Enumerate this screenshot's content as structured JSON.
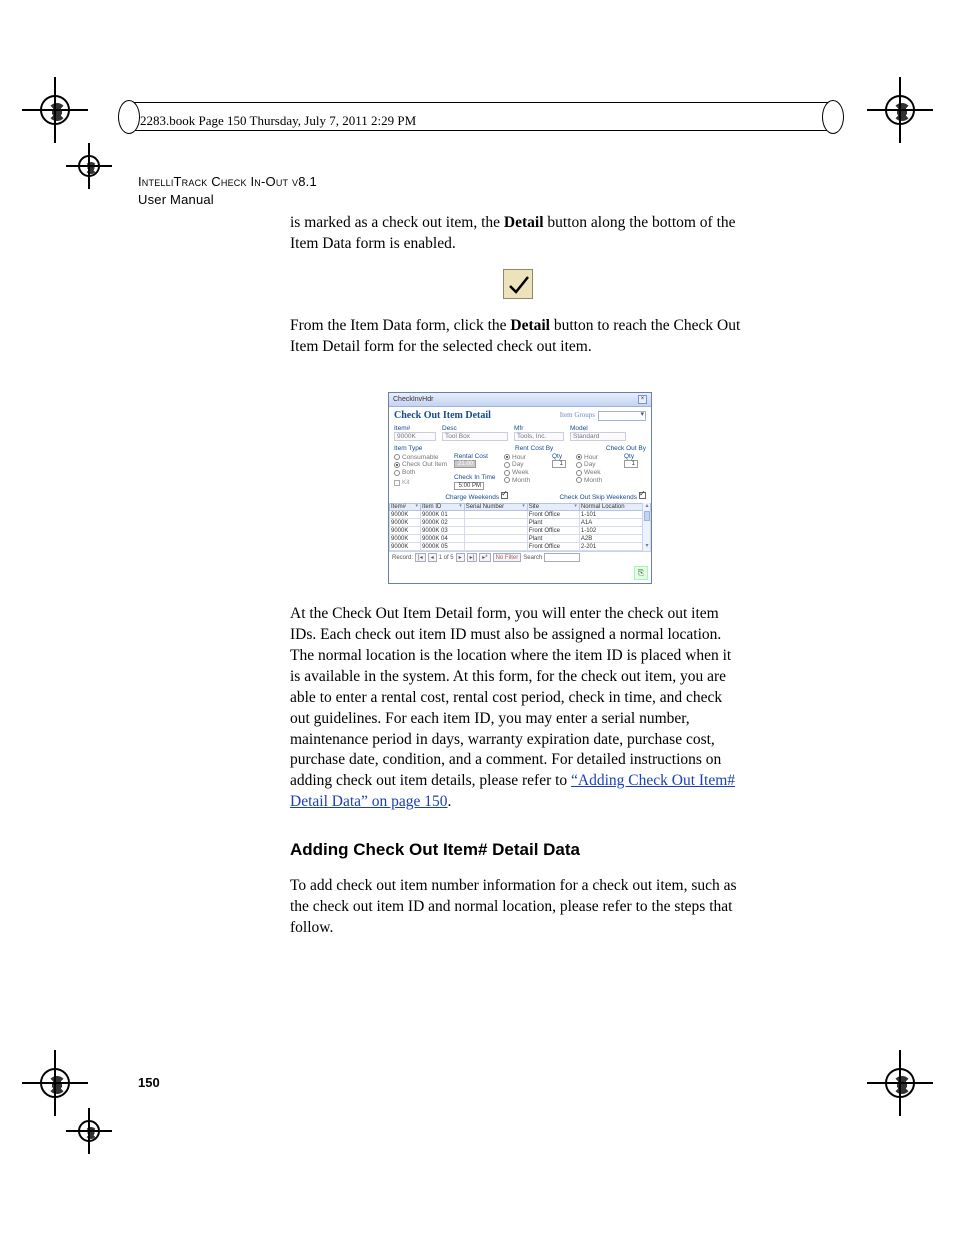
{
  "print_header": "2283.book  Page 150  Thursday, July 7, 2011  2:29 PM",
  "running_head": {
    "line1": "IntelliTrack Check In-Out v8.1",
    "line2": "User Manual"
  },
  "para1_pre": "is marked as a check out item, the ",
  "para1_bold": "Detail",
  "para1_post": " button along the bottom of the Item Data form is enabled.",
  "para2_pre": "From the Item Data form, click the ",
  "para2_bold": "Detail",
  "para2_post": " button to reach the Check Out Item Detail form for the selected check out item.",
  "appwin": {
    "title": "CheckInvHdr",
    "close": "×",
    "form_title": "Check Out Item Detail",
    "group_label": "Item Groups",
    "fields": {
      "item_no": {
        "label": "Item#",
        "value": "9000K"
      },
      "desc": {
        "label": "Desc",
        "value": "Tool Box"
      },
      "mfr": {
        "label": "Mfr",
        "value": "Tools, Inc."
      },
      "model": {
        "label": "Model",
        "value": "Standard"
      }
    },
    "item_type_label": "Item Type",
    "item_type_opts": {
      "consumable": "Consumable",
      "checkout": "Check Out Item",
      "both": "Both"
    },
    "kit_label": "Kit",
    "rental_cost_label": "Rental Cost",
    "rental_cost_value": "21.00",
    "rent_cost_by_label": "Rent Cost By",
    "period_opts": {
      "hour": "Hour",
      "day": "Day",
      "week": "Week",
      "month": "Month"
    },
    "qty_label": "Qty",
    "qty_value": "1",
    "checkin_time_label": "Check In Time",
    "checkin_time_value": "5:00 PM",
    "charge_weekends_label": "Charge Weekends",
    "checkout_by_label": "Check Out By",
    "checkout_qty_value": "1",
    "checkout_skip_weekends_label": "Check Out Skip Weekends",
    "grid": {
      "headers": [
        "Item#",
        "Item ID",
        "Serial Number",
        "Site",
        "Normal Location"
      ],
      "rows": [
        [
          "9000K",
          "9000K 01",
          "",
          "Front Office",
          "1-101"
        ],
        [
          "9000K",
          "9000K 02",
          "",
          "Plant",
          "A1A"
        ],
        [
          "9000K",
          "9000K 03",
          "",
          "Front Office",
          "1-102"
        ],
        [
          "9000K",
          "9000K 04",
          "",
          "Plant",
          "A2B"
        ],
        [
          "9000K",
          "9000K 05",
          "",
          "Front Office",
          "2-201"
        ]
      ]
    },
    "recnav": {
      "record_label": "Record: ",
      "first": "|◂",
      "prev": "◂",
      "pos": "1 of 5",
      "next": "▸",
      "last": "▸|",
      "new": "▸*",
      "nofilter": "No Filter",
      "search": "Search"
    },
    "exit_icon": "⎘"
  },
  "para3": "At the Check Out Item Detail form, you will enter the check out item IDs. Each check out item ID must also be assigned a normal location. The normal location is the location where the item ID is placed when it is available in the system. At this form, for the check out item, you are able to enter a rental cost, rental cost period, check in time, and check out guidelines. For each item ID, you may enter a serial number, maintenance period in days, warranty expiration date, purchase cost, purchase date, condition, and a comment. For detailed instructions on adding check out item details, please refer to ",
  "xref_text": "“Adding Check Out Item# Detail Data” on page 150",
  "para3_tail": ".",
  "h2": "Adding Check Out Item# Detail Data",
  "para4": "To add check out item number information for a check out item, such as the check out item ID and normal location, please refer to the steps that follow.",
  "page_number": "150"
}
